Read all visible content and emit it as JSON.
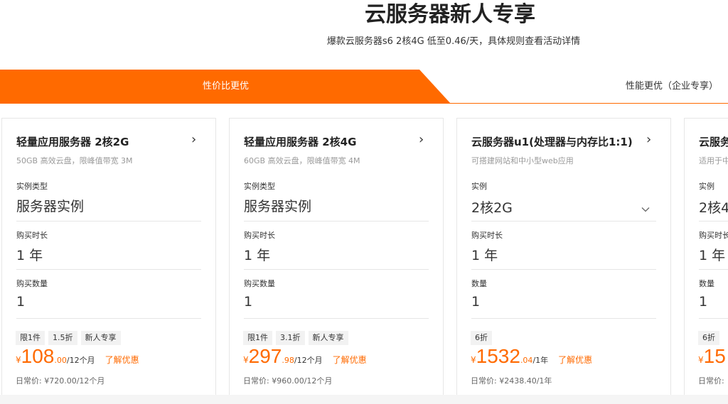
{
  "hero": {
    "title": "云服务器新人专享",
    "subtitle": "爆款云服务器s6 2核4G 低至0.46/天，具体规则查看活动详情"
  },
  "tabs": {
    "active_label": "性价比更优",
    "inactive_label": "性能更优（企业专享）",
    "accent_color": "#ff6a00"
  },
  "cards": [
    {
      "title": "轻量应用服务器 2核2G",
      "desc": "50GB 高效云盘，限峰值带宽 3M",
      "type_label": "实例类型",
      "type_value": "服务器实例",
      "duration_label": "购买时长",
      "duration_value": "1 年",
      "qty_label": "购买数量",
      "qty_value": "1",
      "tags": [
        "限1件",
        "1.5折",
        "新人专享"
      ],
      "currency": "¥",
      "price_int": "108",
      "price_dec": ".00",
      "price_unit": "/12个月",
      "promo": "了解优惠",
      "daily": "日常价: ¥720.00/12个月"
    },
    {
      "title": "轻量应用服务器 2核4G",
      "desc": "60GB 高效云盘，限峰值带宽 4M",
      "type_label": "实例类型",
      "type_value": "服务器实例",
      "duration_label": "购买时长",
      "duration_value": "1 年",
      "qty_label": "购买数量",
      "qty_value": "1",
      "tags": [
        "限1件",
        "3.1折",
        "新人专享"
      ],
      "currency": "¥",
      "price_int": "297",
      "price_dec": ".98",
      "price_unit": "/12个月",
      "promo": "了解优惠",
      "daily": "日常价: ¥960.00/12个月"
    },
    {
      "title": "云服务器u1(处理器与内存比1:1)",
      "desc": "可搭建网站和中小型web应用",
      "type_label": "实例",
      "type_value": "2核2G",
      "duration_label": "购买时长",
      "duration_value": "1 年",
      "qty_label": "数量",
      "qty_value": "1",
      "tags": [
        "6折"
      ],
      "currency": "¥",
      "price_int": "1532",
      "price_dec": ".04",
      "price_unit": "/1年",
      "promo": "了解优惠",
      "daily": "日常价: ¥2438.40/1年"
    },
    {
      "title": "云服务",
      "desc": "适用于中",
      "type_label": "实例",
      "type_value": "2核4",
      "duration_label": "购买时长",
      "duration_value": "1 年",
      "qty_label": "数量",
      "qty_value": "1",
      "tags": [
        "6折"
      ],
      "currency": "¥",
      "price_int": "15",
      "price_dec": "",
      "price_unit": "",
      "promo": "",
      "daily": "日常价:"
    }
  ]
}
